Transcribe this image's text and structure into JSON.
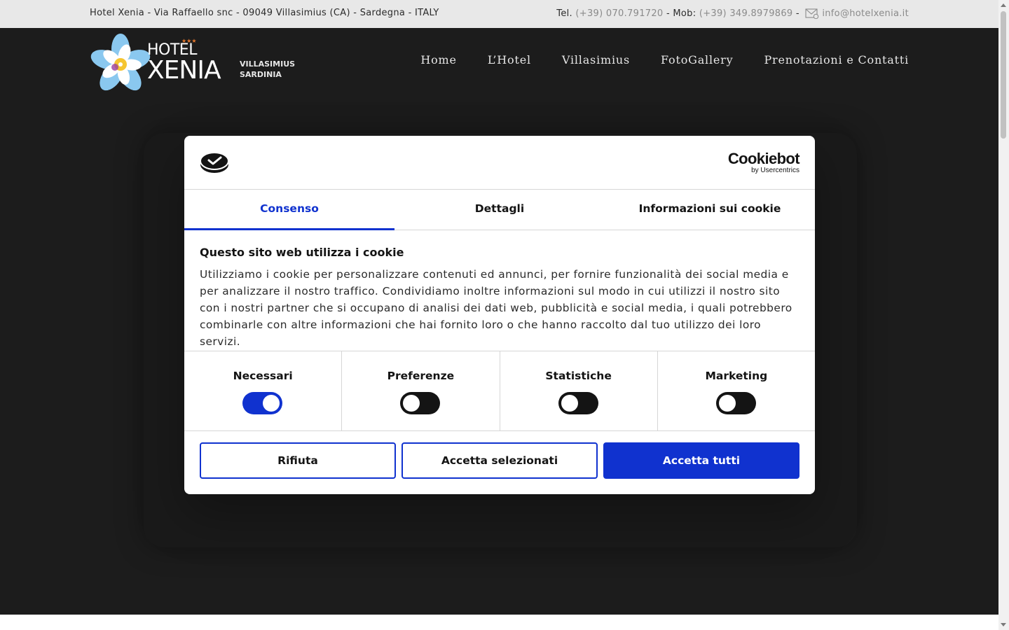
{
  "topbar": {
    "address": "Hotel Xenia - Via Raffaello snc - 09049 Villasimius (CA) - Sardegna - ITALY",
    "tel_label": "Tel.",
    "tel": "(+39) 070.791720",
    "mob_label": "Mob:",
    "mob": "(+39) 349.8979869",
    "separator": "-",
    "email": "info@hotelxenia.it"
  },
  "logo": {
    "hotel": "HOTEL",
    "name": "XENIA",
    "stars": "★★★",
    "place_line1": "VILLASIMIUS",
    "place_line2": "SARDINIA"
  },
  "nav": {
    "items": [
      {
        "label": "Home"
      },
      {
        "label": "L’Hotel"
      },
      {
        "label": "Villasimius"
      },
      {
        "label": "FotoGallery"
      },
      {
        "label": "Prenotazioni e Contatti"
      }
    ]
  },
  "cookie_dialog": {
    "brand_name": "Cookiebot",
    "brand_sub": "by Usercentrics",
    "tabs": [
      {
        "label": "Consenso",
        "active": true
      },
      {
        "label": "Dettagli",
        "active": false
      },
      {
        "label": "Informazioni sui cookie",
        "active": false
      }
    ],
    "heading": "Questo sito web utilizza i cookie",
    "text": "Utilizziamo i cookie per personalizzare contenuti ed annunci, per fornire funzionalità dei social media e per analizzare il nostro traffico. Condividiamo inoltre informazioni sul modo in cui utilizzi il nostro sito con i nostri partner che si occupano di analisi dei dati web, pubblicità e social media, i quali potrebbero combinarle con altre informazioni che hai fornito loro o che hanno raccolto dal tuo utilizzo dei loro servizi.",
    "categories": [
      {
        "label": "Necessari",
        "enabled": true
      },
      {
        "label": "Preferenze",
        "enabled": false
      },
      {
        "label": "Statistiche",
        "enabled": false
      },
      {
        "label": "Marketing",
        "enabled": false
      }
    ],
    "buttons": {
      "reject": "Rifiuta",
      "accept_selected": "Accetta selezionati",
      "accept_all": "Accetta tutti"
    }
  },
  "colors": {
    "accent": "#1032cf",
    "page_dark": "#1c1c1c",
    "topbar": "#e8e8e8"
  }
}
